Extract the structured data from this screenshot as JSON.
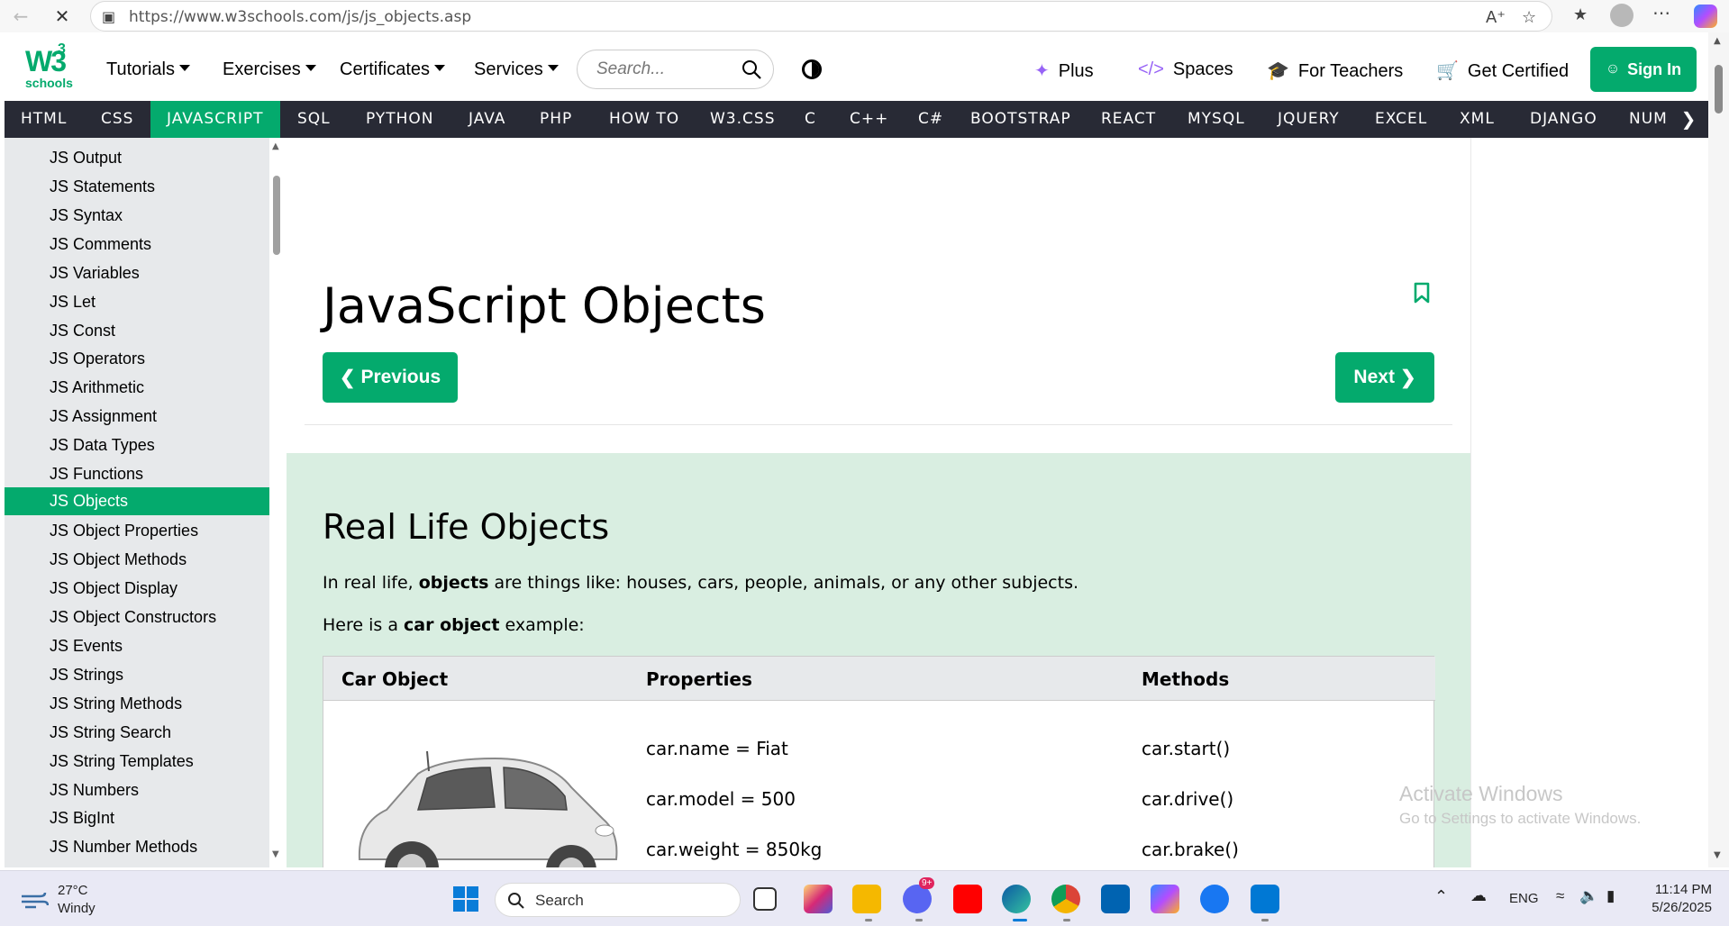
{
  "browser": {
    "url": "https://www.w3schools.com/js/js_objects.asp"
  },
  "header": {
    "logo_main": "W3",
    "logo_sup": "3",
    "logo_sub": "schools",
    "menus": [
      "Tutorials",
      "Exercises",
      "Certificates",
      "Services"
    ],
    "search_placeholder": "Search...",
    "links": {
      "plus": "Plus",
      "spaces": "Spaces",
      "teachers": "For Teachers",
      "certified": "Get Certified"
    },
    "signin": "Sign In",
    "accent_color": "#04aa6d"
  },
  "subjects": [
    "HTML",
    "CSS",
    "JAVASCRIPT",
    "SQL",
    "PYTHON",
    "JAVA",
    "PHP",
    "HOW TO",
    "W3.CSS",
    "C",
    "C++",
    "C#",
    "BOOTSTRAP",
    "REACT",
    "MYSQL",
    "JQUERY",
    "EXCEL",
    "XML",
    "DJANGO",
    "NUMP"
  ],
  "active_subject": "JAVASCRIPT",
  "sidebar": {
    "items": [
      "JS Output",
      "JS Statements",
      "JS Syntax",
      "JS Comments",
      "JS Variables",
      "JS Let",
      "JS Const",
      "JS Operators",
      "JS Arithmetic",
      "JS Assignment",
      "JS Data Types",
      "JS Functions",
      "JS Objects",
      "JS Object Properties",
      "JS Object Methods",
      "JS Object Display",
      "JS Object Constructors",
      "JS Events",
      "JS Strings",
      "JS String Methods",
      "JS String Search",
      "JS String Templates",
      "JS Numbers",
      "JS BigInt",
      "JS Number Methods"
    ],
    "active": "JS Objects"
  },
  "main": {
    "title": "JavaScript Objects",
    "prev": "Previous",
    "next": "Next",
    "section_title": "Real Life Objects",
    "p1_pre": "In real life, ",
    "p1_bold": "objects",
    "p1_post": " are things like: houses, cars, people, animals, or any other subjects.",
    "p2_pre": "Here is a ",
    "p2_bold": "car object",
    "p2_post": " example:",
    "table": {
      "headers": [
        "Car Object",
        "Properties",
        "Methods"
      ],
      "properties": [
        "car.name = Fiat",
        "car.model = 500",
        "car.weight = 850kg"
      ],
      "methods": [
        "car.start()",
        "car.drive()",
        "car.brake()"
      ]
    }
  },
  "watermark": {
    "line1": "Activate Windows",
    "line2": "Go to Settings to activate Windows."
  },
  "taskbar": {
    "temp": "27°C",
    "condition": "Windy",
    "search": "Search",
    "lang": "ENG",
    "time": "11:14 PM",
    "date": "5/26/2025",
    "badge": "9+"
  }
}
